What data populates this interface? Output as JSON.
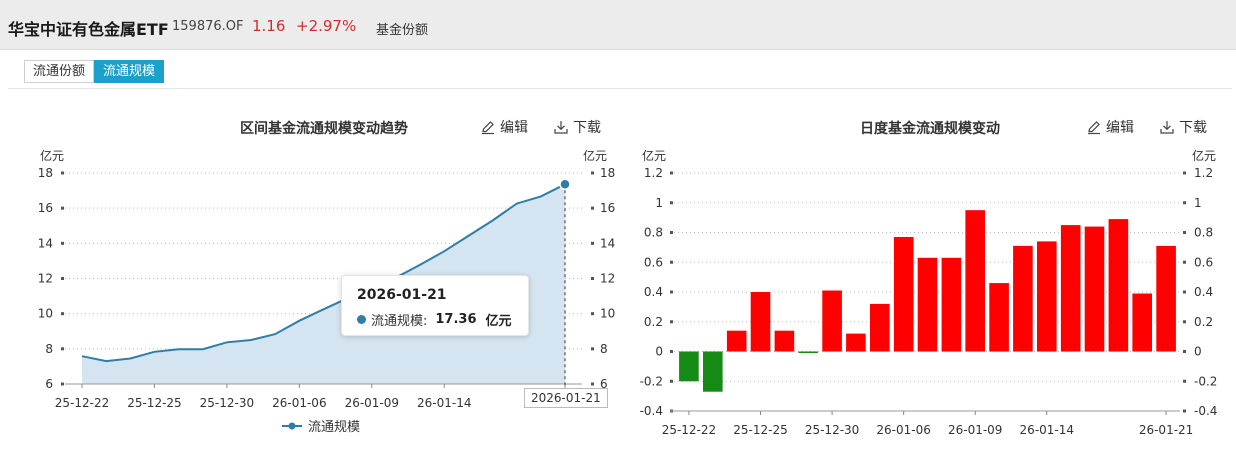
{
  "header": {
    "fund_name": "华宝中证有色金属ETF",
    "fund_code": "159876.OF",
    "price": "1.16",
    "change": "+2.97%",
    "type": "基金份额"
  },
  "tabs": [
    {
      "label": "流通份额",
      "active": false
    },
    {
      "label": "流通规模",
      "active": true
    }
  ],
  "tools": {
    "edit": "编辑",
    "download": "下载"
  },
  "colors": {
    "line": "#2f7ea6",
    "area": "#cfe1ee",
    "positive": "#ff0000",
    "negative": "#158a15",
    "accent": "#1aa0c9"
  },
  "left_chart": {
    "title": "区间基金流通规模变动趋势",
    "unit_left": "亿元",
    "unit_right": "亿元",
    "legend": "流通规模",
    "tooltip": {
      "date": "2026-01-21",
      "label": "流通规模:",
      "value": "17.36",
      "unit": "亿元"
    },
    "crosshair_label": "2026-01-21"
  },
  "right_chart": {
    "title": "日度基金流通规模变动",
    "unit_left": "亿元",
    "unit_right": "亿元"
  },
  "chart_data": [
    {
      "type": "area",
      "title": "区间基金流通规模变动趋势",
      "ylabel": "亿元",
      "ylim": [
        6,
        18
      ],
      "yticks": [
        6,
        8,
        10,
        12,
        14,
        16,
        18
      ],
      "grid": true,
      "legend_position": "bottom",
      "x": [
        "2025-12-22",
        "2025-12-23",
        "2025-12-24",
        "2025-12-25",
        "2025-12-26",
        "2025-12-29",
        "2025-12-30",
        "2025-12-31",
        "2026-01-05",
        "2026-01-06",
        "2026-01-07",
        "2026-01-08",
        "2026-01-09",
        "2026-01-12",
        "2026-01-13",
        "2026-01-14",
        "2026-01-15",
        "2026-01-16",
        "2026-01-19",
        "2026-01-20",
        "2026-01-21"
      ],
      "xtick_labels": [
        "25-12-22",
        "25-12-25",
        "25-12-30",
        "26-01-06",
        "26-01-09",
        "26-01-14",
        "26-01-21"
      ],
      "xtick_dates": [
        "2025-12-22",
        "2025-12-25",
        "2025-12-30",
        "2026-01-06",
        "2026-01-09",
        "2026-01-14",
        "2026-01-21"
      ],
      "series": [
        {
          "name": "流通规模",
          "values": [
            7.58,
            7.3,
            7.45,
            7.83,
            7.98,
            7.98,
            8.37,
            8.5,
            8.84,
            9.6,
            10.25,
            10.88,
            11.34,
            12.05,
            12.78,
            13.55,
            14.42,
            15.3,
            16.26,
            16.67,
            17.36
          ]
        }
      ]
    },
    {
      "type": "bar",
      "title": "日度基金流通规模变动",
      "ylabel": "亿元",
      "ylim": [
        -0.4,
        1.2
      ],
      "yticks": [
        -0.4,
        -0.2,
        0,
        0.2,
        0.4,
        0.6,
        0.8,
        1,
        1.2
      ],
      "grid": true,
      "categories": [
        "2025-12-22",
        "2025-12-23",
        "2025-12-24",
        "2025-12-25",
        "2025-12-26",
        "2025-12-29",
        "2025-12-30",
        "2025-12-31",
        "2026-01-05",
        "2026-01-06",
        "2026-01-07",
        "2026-01-08",
        "2026-01-09",
        "2026-01-12",
        "2026-01-13",
        "2026-01-14",
        "2026-01-15",
        "2026-01-16",
        "2026-01-19",
        "2026-01-20",
        "2026-01-21"
      ],
      "xtick_labels": [
        "25-12-22",
        "25-12-25",
        "25-12-30",
        "26-01-06",
        "26-01-09",
        "26-01-14",
        "26-01-21"
      ],
      "xtick_dates": [
        "2025-12-22",
        "2025-12-25",
        "2025-12-30",
        "2026-01-06",
        "2026-01-09",
        "2026-01-14",
        "2026-01-21"
      ],
      "values": [
        -0.2,
        -0.27,
        0.14,
        0.4,
        0.14,
        -0.01,
        0.41,
        0.12,
        0.32,
        0.77,
        0.63,
        0.63,
        0.95,
        0.46,
        0.71,
        0.74,
        0.85,
        0.84,
        0.89,
        0.39,
        0.71
      ]
    }
  ]
}
